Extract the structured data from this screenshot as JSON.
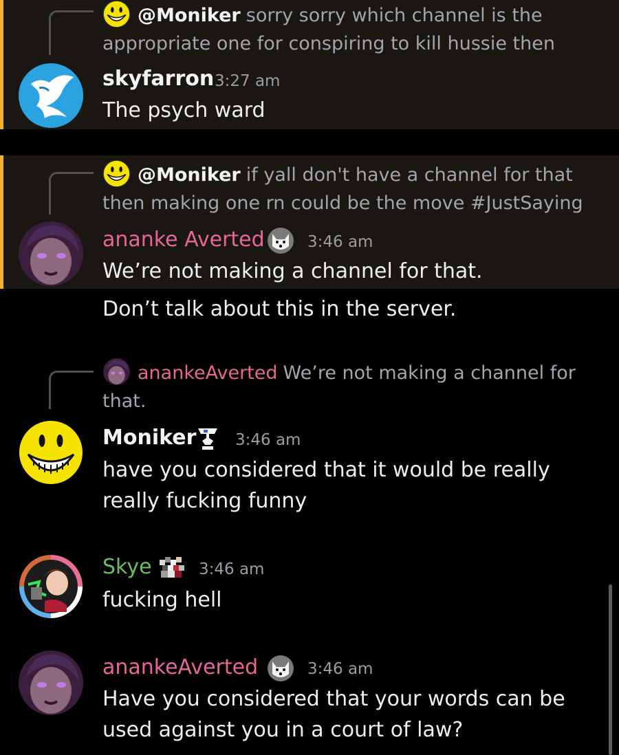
{
  "messages": [
    {
      "reply": {
        "mention": "@Moniker",
        "text": "sorry sorry which channel is the appropriate one for conspiring to kill hussie then"
      },
      "author": "skyfarron",
      "time": "3:27 am",
      "lines": [
        "The psych ward"
      ],
      "highlighted": true
    },
    {
      "reply": {
        "mention": "@Moniker",
        "text": "if yall don't have a channel for that then making one rn could be the move #JustSaying"
      },
      "author": "ananke Averted",
      "time": "3:46 am",
      "lines": [
        "We’re not making a channel for that.",
        "Don’t talk about this in the server."
      ],
      "highlighted": true
    },
    {
      "reply": {
        "mention": "anankeAverted",
        "text": "We’re not making a channel for that."
      },
      "author": "Moniker",
      "time": "3:46 am",
      "lines": [
        "have you considered that it would be really really fucking funny"
      ]
    },
    {
      "author": "Skye",
      "time": "3:46 am",
      "lines": [
        "fucking hell"
      ]
    },
    {
      "author": "anankeAverted",
      "time": "3:46 am",
      "lines": [
        "Have you considered that your words can be used against you in a court of law?"
      ]
    }
  ],
  "colors": {
    "background": "#000000",
    "highlight": "#1a1712",
    "highlight_bar": "#f0b132",
    "pink": "#e8659a",
    "green": "#6cba64",
    "muted": "#a2a5ad"
  },
  "icons": [
    "smiley-avatar",
    "bird-avatar",
    "purple-portrait-avatar",
    "dog-badge",
    "chess-badge",
    "pixel-badge",
    "pride-ring-avatar"
  ]
}
